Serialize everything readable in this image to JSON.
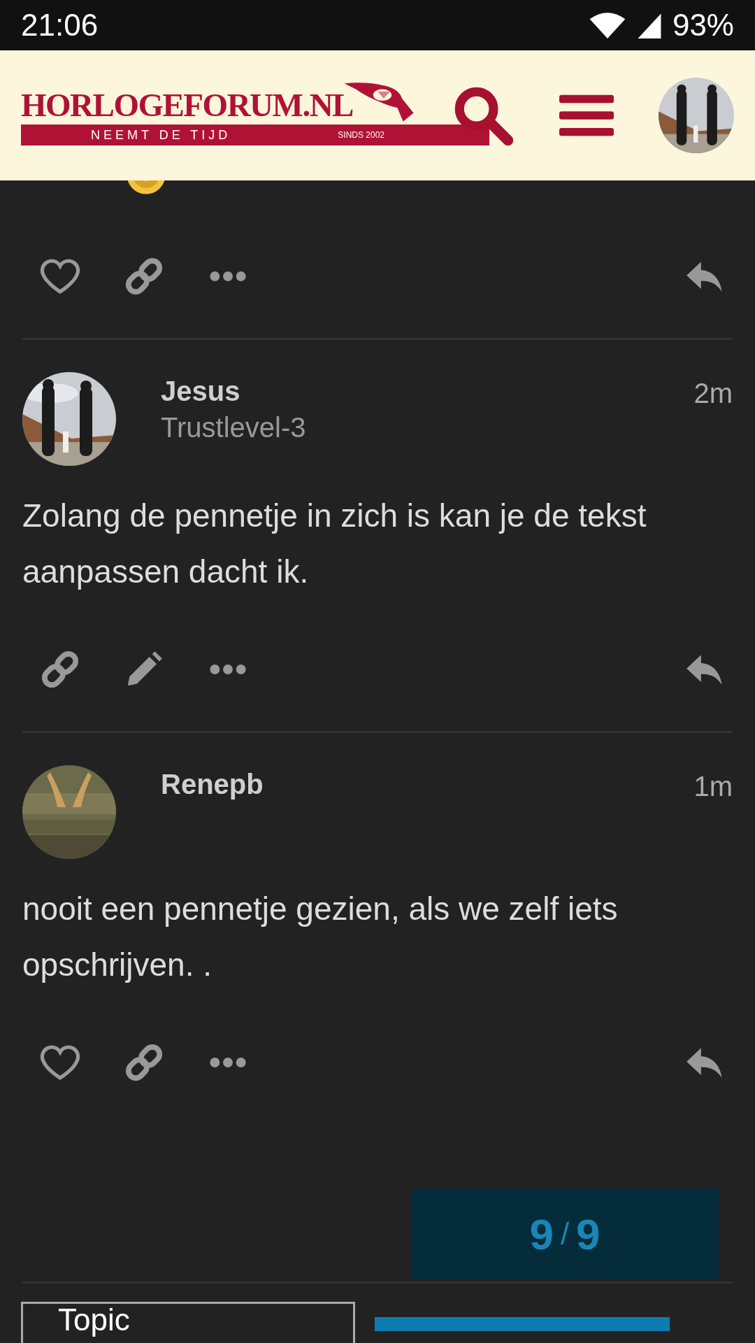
{
  "status_bar": {
    "time": "21:06",
    "battery": "93%"
  },
  "header": {
    "logo_title": "HORLOGEFORUM.NL",
    "logo_tagline": "NEEMT DE TIJD",
    "logo_since": "SINDS 2002"
  },
  "posts": [
    {
      "smiley": true,
      "actions": [
        {
          "kind": "like"
        },
        {
          "kind": "link"
        },
        {
          "kind": "more"
        },
        {
          "kind": "reply"
        }
      ]
    },
    {
      "author": "Jesus",
      "title": "Trustlevel-3",
      "time": "2m",
      "text": "Zolang de pennetje in zich is kan je de tekst aanpassen dacht ik.",
      "actions": [
        {
          "kind": "link"
        },
        {
          "kind": "edit"
        },
        {
          "kind": "more"
        },
        {
          "kind": "reply"
        }
      ]
    },
    {
      "author": "Renepb",
      "time": "1m",
      "text": "nooit een pennetje gezien, als we zelf iets opschrijven. .",
      "actions": [
        {
          "kind": "like"
        },
        {
          "kind": "link"
        },
        {
          "kind": "more"
        },
        {
          "kind": "reply"
        }
      ]
    }
  ],
  "progress": {
    "current": "9",
    "separator": "/",
    "total": "9"
  },
  "footer": {
    "topic_button": "Topic"
  }
}
